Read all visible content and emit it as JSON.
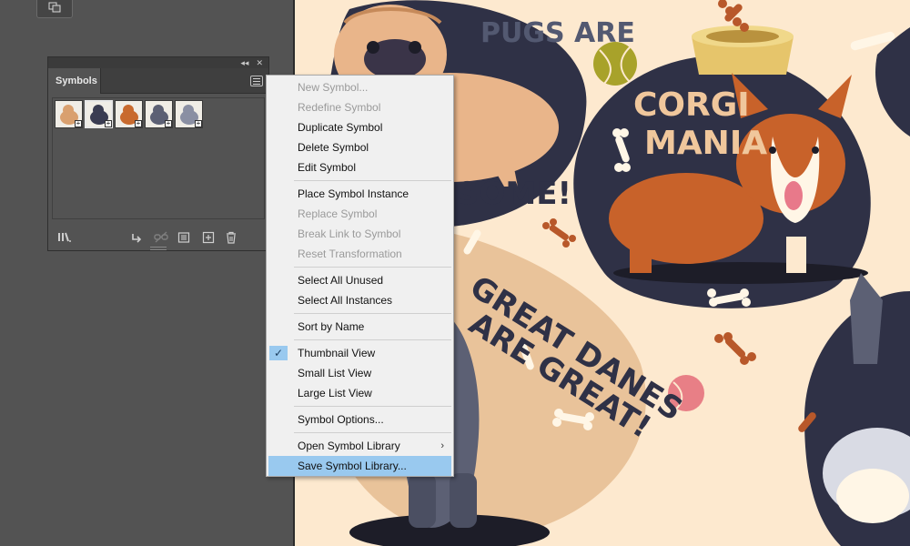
{
  "panel": {
    "title": "Symbols",
    "collapse_glyph": "◂◂",
    "close_glyph": "✕"
  },
  "symbols": [
    {
      "name": "pug-symbol",
      "color": "#d9a06f"
    },
    {
      "name": "dog-dark-symbol",
      "color": "#3a3c52"
    },
    {
      "name": "corgi-symbol",
      "color": "#c86a2e"
    },
    {
      "name": "great-dane-symbol",
      "color": "#5c6074"
    },
    {
      "name": "dog-grey-symbol",
      "color": "#8a8fa3"
    }
  ],
  "footer_icons": [
    "library-icon",
    "place-instance-icon",
    "break-link-icon",
    "symbol-options-icon",
    "new-symbol-icon",
    "trash-icon"
  ],
  "menu": {
    "items": [
      {
        "label": "New Symbol...",
        "disabled": true
      },
      {
        "label": "Redefine Symbol",
        "disabled": true
      },
      {
        "label": "Duplicate Symbol",
        "disabled": false
      },
      {
        "label": "Delete Symbol",
        "disabled": false
      },
      {
        "label": "Edit Symbol",
        "disabled": false
      },
      {
        "sep": true
      },
      {
        "label": "Place Symbol Instance",
        "disabled": false
      },
      {
        "label": "Replace Symbol",
        "disabled": true
      },
      {
        "label": "Break Link to Symbol",
        "disabled": true
      },
      {
        "label": "Reset Transformation",
        "disabled": true
      },
      {
        "sep": true
      },
      {
        "label": "Select All Unused",
        "disabled": false
      },
      {
        "label": "Select All Instances",
        "disabled": false
      },
      {
        "sep": true
      },
      {
        "label": "Sort by Name",
        "disabled": false
      },
      {
        "sep": true
      },
      {
        "label": "Thumbnail View",
        "disabled": false,
        "checked": true
      },
      {
        "label": "Small List View",
        "disabled": false
      },
      {
        "label": "Large List View",
        "disabled": false
      },
      {
        "sep": true
      },
      {
        "label": "Symbol Options...",
        "disabled": false
      },
      {
        "sep": true
      },
      {
        "label": "Open Symbol Library",
        "disabled": false,
        "submenu": true
      },
      {
        "label": "Save Symbol Library...",
        "disabled": false,
        "highlighted": true
      }
    ]
  },
  "artwork": {
    "pugs_line1": "PUGS ARE",
    "pugs_line2": "SOME!",
    "corgi_line1": "CORGI",
    "corgi_line2": "MANIA",
    "danes_line1": "GREAT DANES",
    "danes_line2": "ARE GREAT!",
    "colors": {
      "background": "#fde9cf",
      "navy": "#2f3146",
      "tan": "#e9c39a",
      "corgi": "#c8622a",
      "bone": "#fff6e6",
      "bone_brown": "#b8582a",
      "tennis": "#a8a22a",
      "pink_ball": "#e87f86",
      "grey_dog": "#5c6074",
      "dark_dog": "#2b2e3f"
    }
  }
}
